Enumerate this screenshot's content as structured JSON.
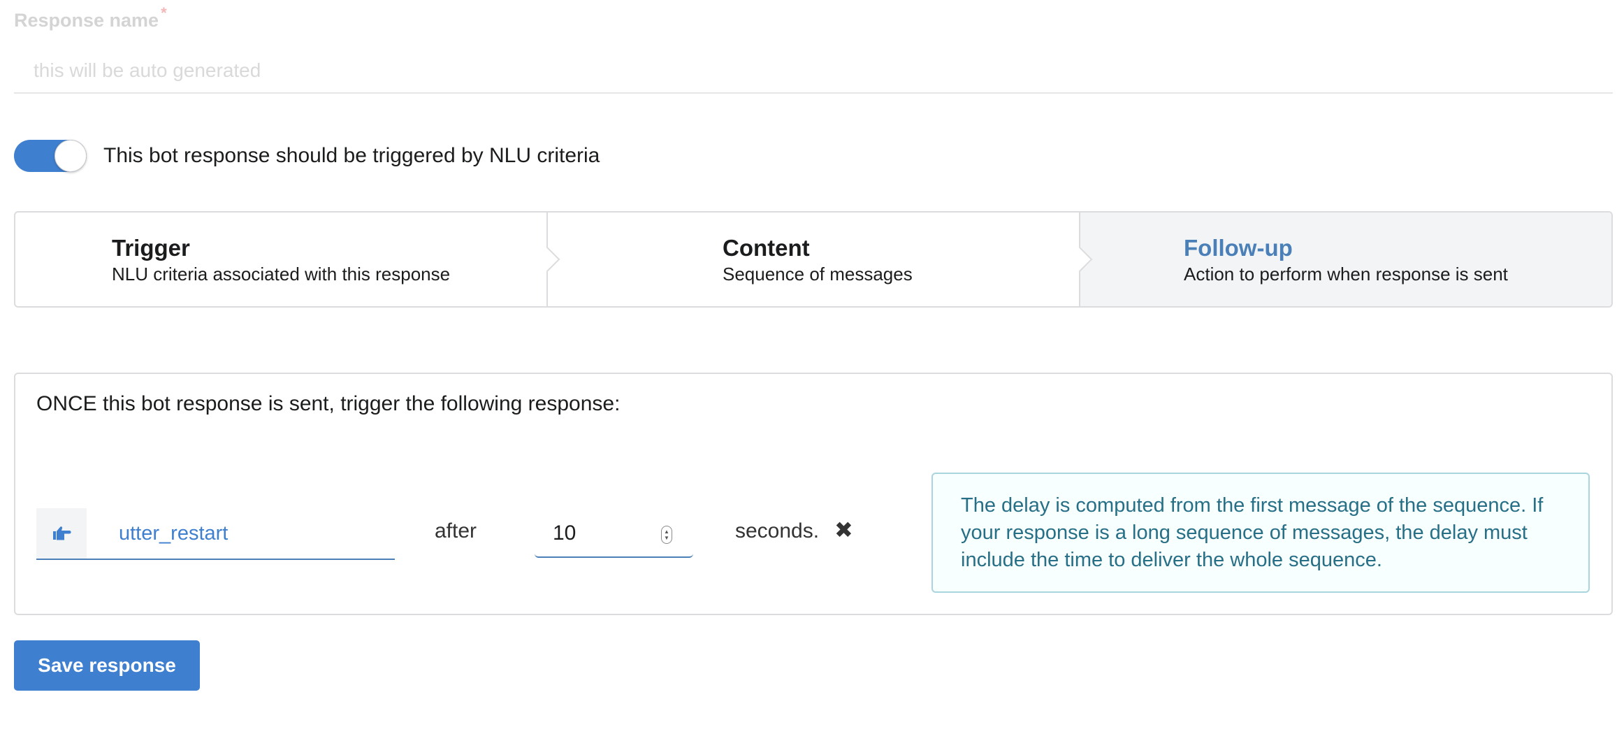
{
  "response_name": {
    "label": "Response name",
    "required_mark": "*",
    "placeholder": "this will be auto generated",
    "value": ""
  },
  "nlu_toggle": {
    "on": true,
    "label": "This bot response should be triggered by NLU criteria"
  },
  "steps": [
    {
      "title": "Trigger",
      "description": "NLU criteria associated with this response",
      "active": false
    },
    {
      "title": "Content",
      "description": "Sequence of messages",
      "active": false
    },
    {
      "title": "Follow-up",
      "description": "Action to perform when response is sent",
      "active": true
    }
  ],
  "follow_up": {
    "heading": "ONCE this bot response is sent, trigger the following response:",
    "response_icon": "hand-pointing-right-icon",
    "response_value": "utter_restart",
    "after_label": "after",
    "delay_value": "10",
    "seconds_label": "seconds.",
    "remove_icon": "close-icon",
    "info_text": "The delay is computed from the first message of the sequence. If your response is a long sequence of messages, the delay must include the time to deliver the whole sequence."
  },
  "save_button": {
    "label": "Save response"
  },
  "colors": {
    "primary": "#3f7fd0",
    "active_step_title": "#4a7fb8",
    "info_text": "#276f86",
    "info_border": "#a9d5de"
  }
}
